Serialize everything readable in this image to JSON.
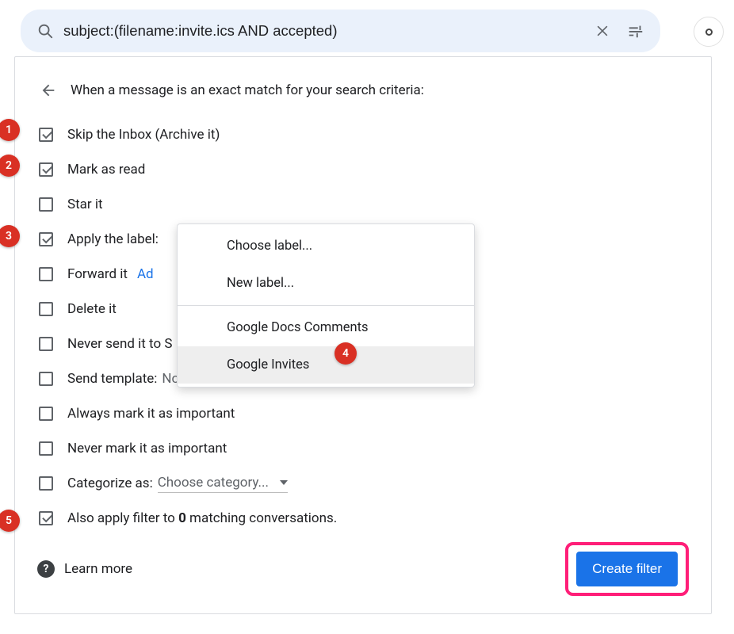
{
  "search": {
    "query": "subject:(filename:invite.ics AND accepted)"
  },
  "header": {
    "title": "When a message is an exact match for your search criteria:"
  },
  "options": {
    "skip_inbox": {
      "label": "Skip the Inbox (Archive it)",
      "checked": true
    },
    "mark_read": {
      "label": "Mark as read",
      "checked": true
    },
    "star": {
      "label": "Star it",
      "checked": false
    },
    "apply_label": {
      "label": "Apply the label:",
      "checked": true
    },
    "forward": {
      "label": "Forward it",
      "checked": false,
      "link": "Ad"
    },
    "delete": {
      "label": "Delete it",
      "checked": false
    },
    "never_spam": {
      "label": "Never send it to S",
      "checked": false
    },
    "send_template": {
      "label": "Send template:",
      "checked": false,
      "value": "No templates"
    },
    "always_important": {
      "label": "Always mark it as important",
      "checked": false
    },
    "never_important": {
      "label": "Never mark it as important",
      "checked": false
    },
    "categorize": {
      "label": "Categorize as:",
      "checked": false,
      "value": "Choose category..."
    },
    "also_apply": {
      "prefix": "Also apply filter to ",
      "count": "0",
      "suffix": " matching conversations.",
      "checked": true
    }
  },
  "dropdown": {
    "choose_label": "Choose label...",
    "new_label": "New label...",
    "item_docs": "Google Docs Comments",
    "item_invites": "Google Invites"
  },
  "footer": {
    "learn_more": "Learn more",
    "create_filter": "Create filter"
  },
  "badges": {
    "b1": "1",
    "b2": "2",
    "b3": "3",
    "b4": "4",
    "b5": "5"
  }
}
